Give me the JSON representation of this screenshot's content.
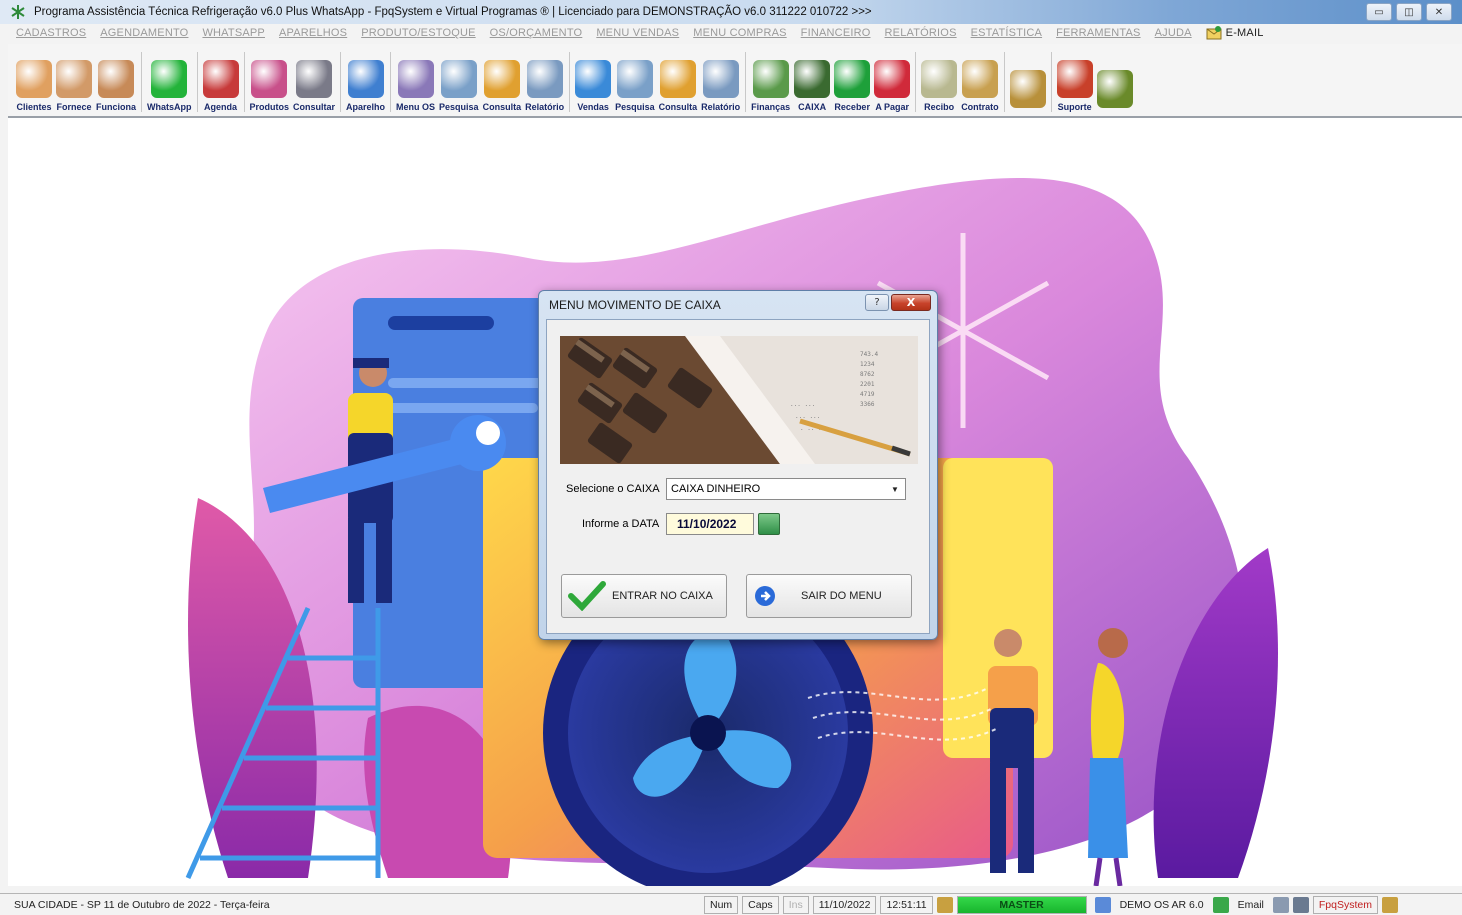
{
  "window": {
    "title": "Programa Assistência Técnica Refrigeração v6.0 Plus WhatsApp - FpqSystem e Virtual Programas ® | Licenciado para  DEMONSTRAÇÃO v6.0 311222 010722 >>>",
    "controls": [
      "minimize",
      "maximize",
      "close"
    ]
  },
  "menu": {
    "items": [
      "CADASTROS",
      "AGENDAMENTO",
      "WHATSAPP",
      "APARELHOS",
      "PRODUTO/ESTOQUE",
      "OS/ORÇAMENTO",
      "MENU VENDAS",
      "MENU COMPRAS",
      "FINANCEIRO",
      "RELATÓRIOS",
      "ESTATÍSTICA",
      "FERRAMENTAS",
      "AJUDA"
    ],
    "email_label": "E-MAIL"
  },
  "toolbar": {
    "buttons": [
      {
        "label": "Clientes",
        "icon": "clients-icon",
        "color": "#e0a060"
      },
      {
        "label": "Fornece",
        "icon": "supplier-icon",
        "color": "#d29a68"
      },
      {
        "label": "Funciona",
        "icon": "employees-icon",
        "color": "#c78a58"
      },
      {
        "label": "WhatsApp",
        "icon": "whatsapp-icon",
        "color": "#23b33a"
      },
      {
        "label": "Agenda",
        "icon": "calendar-icon",
        "color": "#c73a3a"
      },
      {
        "label": "Produtos",
        "icon": "products-icon",
        "color": "#c8508a"
      },
      {
        "label": "Consultar",
        "icon": "consult-products-icon",
        "color": "#7a7a88"
      },
      {
        "label": "Aparelho",
        "icon": "appliance-icon",
        "color": "#3f7fd0"
      },
      {
        "label": "Menu OS",
        "icon": "tools-icon",
        "color": "#8a78b8"
      },
      {
        "label": "Pesquisa",
        "icon": "search-icon",
        "color": "#7aa0c8"
      },
      {
        "label": "Consulta",
        "icon": "folder-icon",
        "color": "#e0a030"
      },
      {
        "label": "Relatório",
        "icon": "printer-icon",
        "color": "#7a9ac0"
      },
      {
        "label": "Vendas",
        "icon": "monitor-icon",
        "color": "#3a8ad8"
      },
      {
        "label": "Pesquisa",
        "icon": "search-icon",
        "color": "#7aa0c8"
      },
      {
        "label": "Consulta",
        "icon": "folder-icon",
        "color": "#e0a030"
      },
      {
        "label": "Relatório",
        "icon": "printer-icon",
        "color": "#7a9ac0"
      },
      {
        "label": "Finanças",
        "icon": "finance-icon",
        "color": "#5a9a4a"
      },
      {
        "label": "CAIXA",
        "icon": "cash-register-icon",
        "color": "#3a6a30"
      },
      {
        "label": "Receber",
        "icon": "receive-money-icon",
        "color": "#1ea03a"
      },
      {
        "label": "A Pagar",
        "icon": "pay-money-icon",
        "color": "#d02a3a"
      },
      {
        "label": "Recibo",
        "icon": "receipt-icon",
        "color": "#b8b890"
      },
      {
        "label": "Contrato",
        "icon": "contract-icon",
        "color": "#c8a050"
      },
      {
        "label": "",
        "icon": "coin-icon",
        "color": "#b8903a"
      },
      {
        "label": "Suporte",
        "icon": "support-icon",
        "color": "#c8402a"
      },
      {
        "label": "",
        "icon": "exit-icon",
        "color": "#6a8a2a"
      }
    ]
  },
  "dialog": {
    "title": "MENU MOVIMENTO DE CAIXA",
    "help_label": "?",
    "close_label": "X",
    "caixa_label": "Selecione o CAIXA",
    "caixa_value": "CAIXA DINHEIRO",
    "data_label": "Informe a DATA",
    "data_value": "11/10/2022",
    "enter_button": "ENTRAR NO CAIXA",
    "exit_button": "SAIR DO MENU"
  },
  "statusbar": {
    "city": "SUA CIDADE - SP 11 de Outubro de 2022 - Terça-feira",
    "num": "Num",
    "caps": "Caps",
    "ins": "Ins",
    "date": "11/10/2022",
    "time": "12:51:11",
    "user": "MASTER",
    "database": "DEMO OS AR 6.0",
    "email": "Email",
    "brand": "FpqSystem"
  },
  "colors": {
    "accent_blue": "#5c8fc9",
    "status_green": "#22c83a",
    "brand_red": "#c02020"
  }
}
